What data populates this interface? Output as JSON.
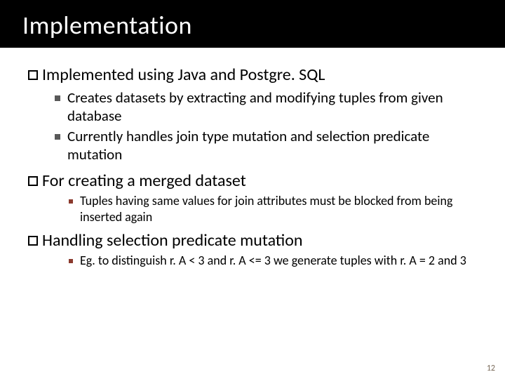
{
  "title": "Implementation",
  "sections": [
    {
      "heading": "Implemented using Java and Postgre. SQL",
      "bullets_level1": [
        "Creates datasets by extracting and modifying tuples from given database",
        "Currently handles join type mutation and selection predicate mutation"
      ],
      "bullets_level2": []
    },
    {
      "heading": "For creating a merged dataset",
      "bullets_level1": [],
      "bullets_level2": [
        "Tuples having same values for join attributes must be blocked from being inserted again"
      ]
    },
    {
      "heading": "Handling selection predicate mutation",
      "bullets_level1": [],
      "bullets_level2": [
        "Eg. to distinguish r. A < 3 and r. A <= 3 we generate tuples with r. A = 2 and 3"
      ]
    }
  ],
  "page_number": "12"
}
